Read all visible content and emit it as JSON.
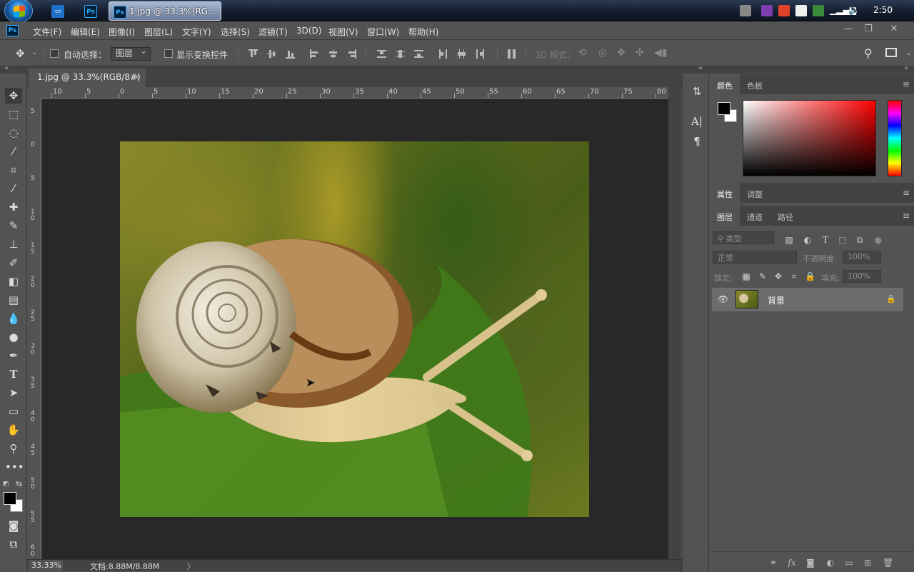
{
  "taskbar": {
    "active_window_label": "1.jpg @ 33.3%(RG...",
    "clock": "2:50"
  },
  "menu": {
    "items": [
      "文件(F)",
      "编辑(E)",
      "图像(I)",
      "图层(L)",
      "文字(Y)",
      "选择(S)",
      "滤镜(T)",
      "3D(D)",
      "视图(V)",
      "窗口(W)",
      "帮助(H)"
    ]
  },
  "options": {
    "auto_select_label": "自动选择：",
    "auto_select_target": "图层",
    "show_transform_label": "显示变换控件",
    "mode_3d_label": "3D 模式："
  },
  "document": {
    "tab_title": "1.jpg @ 33.3%(RGB/8#)",
    "tab_close": "×",
    "ruler_top": [
      "10",
      "5",
      "0",
      "5",
      "10",
      "15",
      "20",
      "25",
      "30",
      "35",
      "40",
      "45",
      "50",
      "55",
      "60",
      "65",
      "70",
      "75",
      "80"
    ],
    "ruler_left": [
      "5",
      "0",
      "5",
      "10",
      "15",
      "20",
      "25",
      "30",
      "35",
      "40",
      "45",
      "50",
      "55",
      "60"
    ]
  },
  "status": {
    "zoom": "33.33%",
    "doc_info": "文档:8.88M/8.88M",
    "arrow": "〉"
  },
  "panels": {
    "color_tabs": [
      "颜色",
      "色板"
    ],
    "props_tabs": [
      "属性",
      "调整"
    ],
    "layer_tabs": [
      "图层",
      "通道",
      "路径"
    ],
    "filter_placeholder": "类型",
    "blend_mode": "正常",
    "opacity_label": "不透明度:",
    "opacity_value": "100%",
    "lock_label": "锁定:",
    "fill_label": "填充:",
    "fill_value": "100%",
    "layer_name": "背景"
  },
  "colors": {
    "foreground": "#000000",
    "background": "#ffffff",
    "picker_hue": "#ff0000"
  }
}
